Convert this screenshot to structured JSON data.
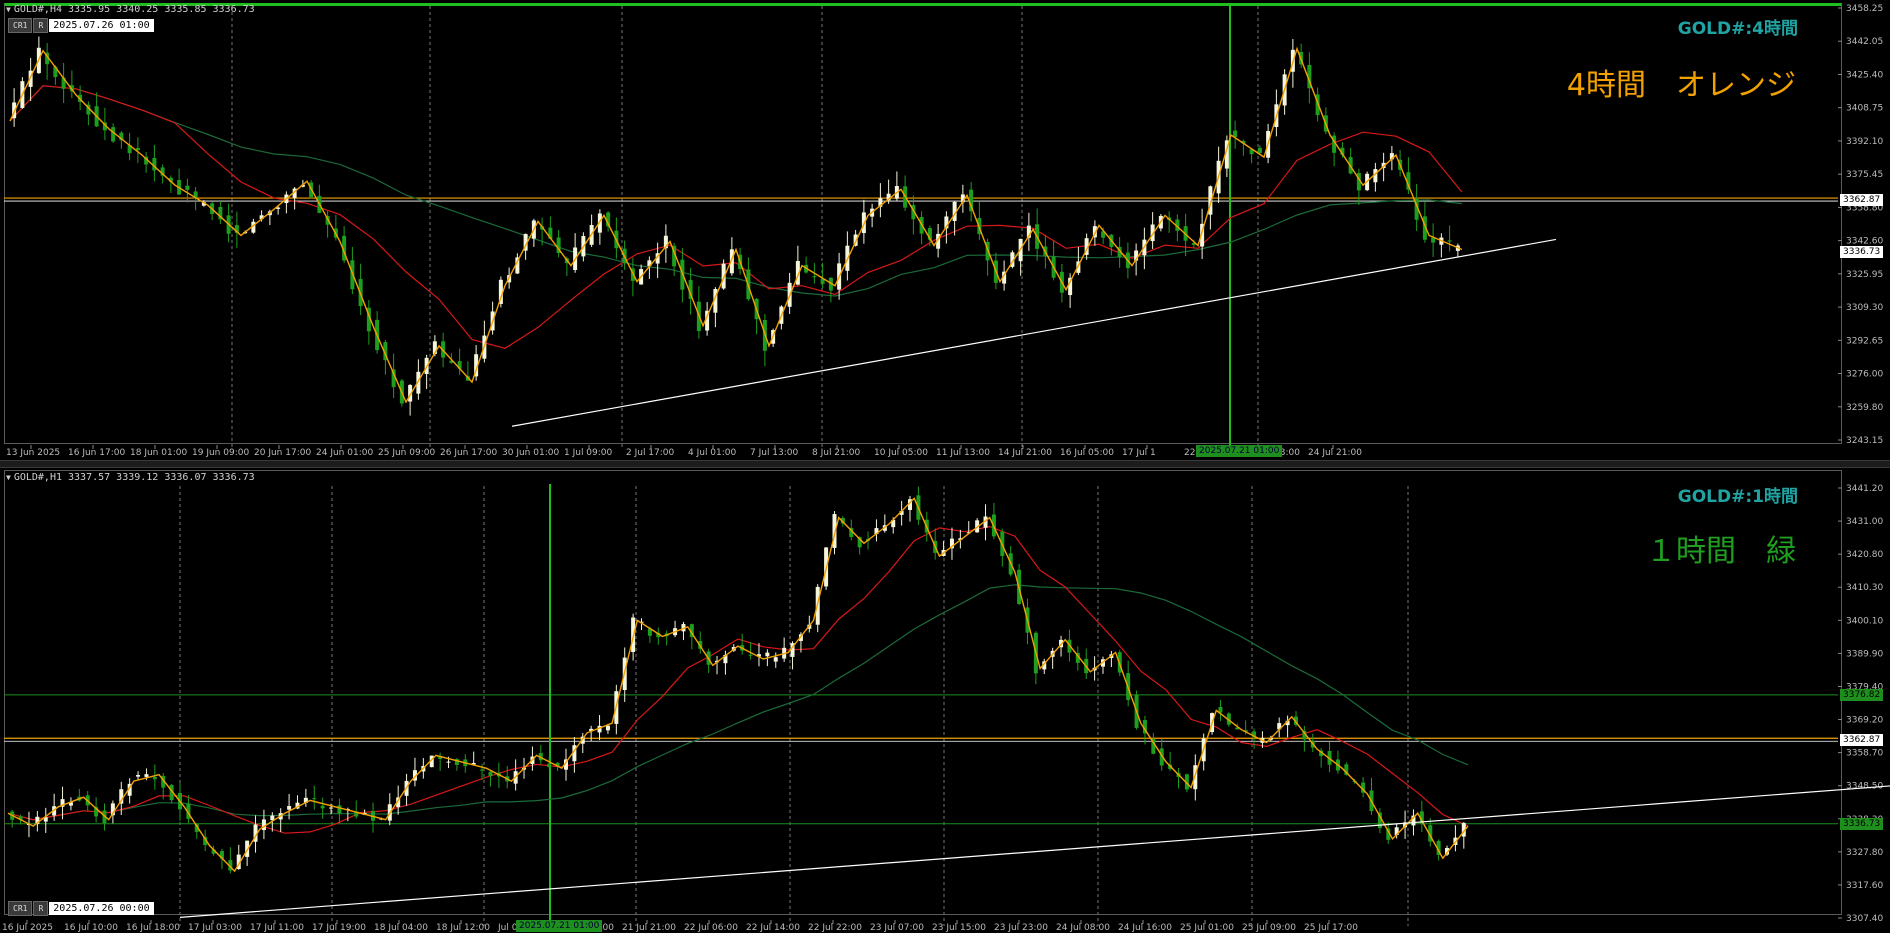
{
  "panes": [
    {
      "id": "h4",
      "header": "GOLD#,H4  3335.95 3340.25 3335.85 3336.73",
      "stamp_buttons": [
        "CR1",
        "R"
      ],
      "stamp_value": "2025.07.26 01:00",
      "symbol_label": "GOLD#:4時間",
      "note_text": "4時間　オレンジ",
      "note_color": "#f2a200",
      "symbol_color": "#1fa3a3",
      "price_axis": [
        "3458.25",
        "3442.05",
        "3425.40",
        "3408.75",
        "3392.10",
        "3375.45",
        "3358.80",
        "3342.60",
        "3325.95",
        "3309.30",
        "3292.65",
        "3276.00",
        "3259.80",
        "3243.15"
      ],
      "time_axis": [
        "13 Jun 2025",
        "16 Jun 17:00",
        "18 Jun 01:00",
        "19 Jun 09:00",
        "20 Jun 17:00",
        "24 Jun 01:00",
        "25 Jun 09:00",
        "26 Jun 17:00",
        "30 Jun 01:00",
        "1 Jul 09:00",
        "2 Jul 17:00",
        "4 Jul 01:00",
        "7 Jul 13:00",
        "8 Jul 21:00",
        "10 Jul 05:00",
        "11 Jul 13:00",
        "14 Jul 21:00",
        "16 Jul 05:00",
        "17 Jul 1",
        "22 Jul 05:00",
        "23 Jul 13:00",
        "24 Jul 21:00"
      ],
      "time_cursor_label": "2025.07.21 01:00",
      "price_tags": [
        {
          "label": "3362.87",
          "bg": "#ffffff",
          "fg": "#000000"
        },
        {
          "label": "3336.73",
          "bg": "#ffffff",
          "fg": "#000000"
        }
      ],
      "colors": {
        "candle_up": "#f5f5dc",
        "candle_down": "#1e9e1e",
        "zigzag": "#f2a200",
        "ma_fast": "#d81818",
        "ma_slow": "#1b6a3a",
        "trendline": "#ffffff",
        "hline": "#f2a200",
        "vline": "#1fbf1f"
      }
    },
    {
      "id": "h1",
      "header": "GOLD#,H1  3337.57 3339.12 3336.07 3336.73",
      "stamp_buttons": [
        "CR1",
        "R"
      ],
      "stamp_value": "2025.07.26 00:00",
      "symbol_label": "GOLD#:1時間",
      "note_text": "１時間　緑",
      "note_color": "#1f9e1f",
      "symbol_color": "#1fa3a3",
      "price_axis": [
        "3441.20",
        "3431.00",
        "3420.80",
        "3410.30",
        "3400.10",
        "3389.90",
        "3379.40",
        "3369.20",
        "3358.70",
        "3348.50",
        "3338.30",
        "3327.80",
        "3317.60",
        "3307.40"
      ],
      "time_axis": [
        "16 Jul 2025",
        "16 Jul 10:00",
        "16 Jul 18:00",
        "17 Jul 03:00",
        "17 Jul 11:00",
        "17 Jul 19:00",
        "18 Jul 04:00",
        "18 Jul 12:00",
        "Jul 05:00",
        "21 Jul 13:00",
        "21 Jul 21:00",
        "22 Jul 06:00",
        "22 Jul 14:00",
        "22 Jul 22:00",
        "23 Jul 07:00",
        "23 Jul 15:00",
        "23 Jul 23:00",
        "24 Jul 08:00",
        "24 Jul 16:00",
        "25 Jul 01:00",
        "25 Jul 09:00",
        "25 Jul 17:00"
      ],
      "time_cursor_label": "2025.07.21 01:00",
      "price_tags": [
        {
          "label": "3376.82",
          "bg": "#1e8f1e",
          "fg": "#000000"
        },
        {
          "label": "3362.87",
          "bg": "#ffffff",
          "fg": "#000000"
        },
        {
          "label": "3336.73",
          "bg": "#1e8f1e",
          "fg": "#000000"
        }
      ],
      "colors": {
        "candle_up": "#f5f5dc",
        "candle_down": "#1e9e1e",
        "zigzag": "#f2a200",
        "ma_fast": "#d81818",
        "ma_slow": "#1b6a3a",
        "trendline": "#ffffff",
        "hline": "#f2a200",
        "vline": "#1fbf1f",
        "hline_green": "#1e8f1e"
      }
    }
  ],
  "chart_data": [
    {
      "type": "candlestick",
      "symbol": "GOLD#",
      "timeframe": "H4",
      "ylim": [
        3243.15,
        3458.25
      ],
      "last_ohlc": {
        "open": 3335.95,
        "high": 3340.25,
        "low": 3335.85,
        "close": 3336.73
      },
      "horizontal_lines": [
        3362.87
      ],
      "zigzag_close_path": [
        3402,
        3437,
        3415,
        3398,
        3385,
        3370,
        3360,
        3345,
        3358,
        3372,
        3342,
        3300,
        3262,
        3290,
        3272,
        3320,
        3352,
        3330,
        3355,
        3322,
        3342,
        3300,
        3338,
        3290,
        3330,
        3320,
        3355,
        3368,
        3340,
        3365,
        3322,
        3348,
        3318,
        3350,
        3330,
        3355,
        3340,
        3395,
        3384,
        3438,
        3395,
        3370,
        3385,
        3345,
        3338
      ]
    },
    {
      "type": "candlestick",
      "symbol": "GOLD#",
      "timeframe": "H1",
      "ylim": [
        3307.4,
        3441.2
      ],
      "last_ohlc": {
        "open": 3337.57,
        "high": 3339.12,
        "low": 3336.07,
        "close": 3336.73
      },
      "horizontal_lines": [
        3376.82,
        3362.87,
        3336.73
      ],
      "zigzag_close_path": [
        3340,
        3336,
        3342,
        3345,
        3338,
        3350,
        3352,
        3342,
        3330,
        3322,
        3335,
        3340,
        3344,
        3342,
        3340,
        3338,
        3350,
        3358,
        3356,
        3354,
        3350,
        3358,
        3354,
        3365,
        3368,
        3400,
        3395,
        3398,
        3386,
        3392,
        3388,
        3390,
        3400,
        3432,
        3424,
        3430,
        3438,
        3420,
        3426,
        3432,
        3415,
        3385,
        3394,
        3384,
        3390,
        3368,
        3356,
        3348,
        3372,
        3366,
        3362,
        3370,
        3360,
        3354,
        3346,
        3332,
        3340,
        3326,
        3336
      ]
    }
  ]
}
